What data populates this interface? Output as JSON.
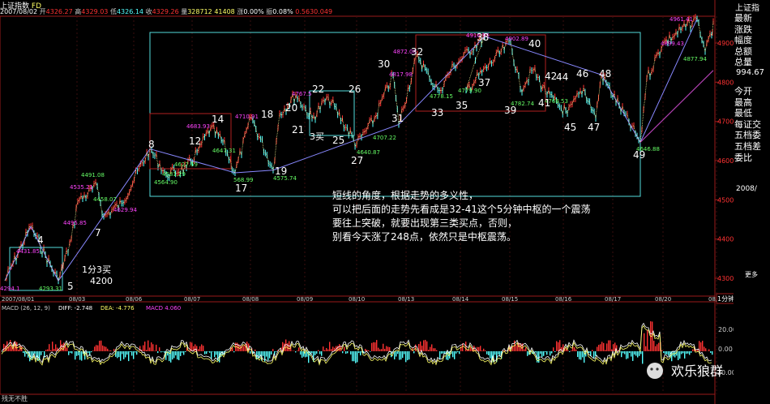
{
  "header": {
    "title": "上证指数",
    "period": "FD",
    "date": "2007/08/02",
    "open_label": "开",
    "open": "4326.27",
    "high_label": "高",
    "high": "4329.03",
    "low_label": "低",
    "low": "4326.14",
    "close_label": "收",
    "close": "4329.26",
    "volume_label": "量",
    "volume": "328712",
    "amount": "41408",
    "change_label": "涨",
    "change": "0.00%",
    "amplitude_label": "振",
    "amplitude": "0.08%",
    "extra": "0.5630.049"
  },
  "right_panel": {
    "title": "上证指",
    "items": [
      "最新",
      "涨跌",
      "幅度",
      "总额",
      "总量",
      "今开",
      "最高",
      "最低",
      "每证交",
      "五档委",
      "五档差",
      "委比"
    ],
    "price": "994.67",
    "misc": [
      "2008/",
      "更多"
    ],
    "period_button": "1分钟"
  },
  "chart_data": {
    "type": "line",
    "title": "",
    "xlabel": "",
    "ylabel": "",
    "ylim": [
      4270,
      4990
    ],
    "x_ticks": [
      "2007/08/01",
      "08/03",
      "08/06",
      "08/07",
      "08/08",
      "08/09",
      "08/10",
      "08/13",
      "08/14",
      "08/15",
      "08/16",
      "08/17",
      "08/20",
      "08/21"
    ],
    "y_ticks": [
      4300,
      4400,
      4500,
      4600,
      4700,
      4800,
      4900
    ],
    "series": [
      {
        "values": [
          4294.1,
          4431.85,
          4293.31,
          4400,
          4495.85,
          4535.21,
          4458.07,
          4491.08,
          4629.94,
          4564.9,
          4581.29,
          4627.69,
          4683.93,
          4647.31,
          4568.99,
          4710.91,
          4575.74,
          4720.0,
          4767.5,
          4708.0,
          4762.0,
          4640.87,
          4707.22,
          4817.98,
          4692.2,
          4872.08,
          4809.0,
          4778.15,
          4842.18,
          4916.95,
          4779.9,
          4902.89,
          4782.74,
          4830.0,
          4768.53,
          4720.0,
          4785.0,
          4708.0,
          4819.0,
          4646.88,
          4810.0,
          4899.43,
          4961.41,
          4877.94,
          4920.0,
          4955.0
        ]
      }
    ],
    "wave_labels": [
      "4",
      "5",
      "7",
      "8",
      "12",
      "14",
      "17",
      "18",
      "19",
      "20",
      "21",
      "22",
      "25",
      "26",
      "27",
      "30",
      "31",
      "32",
      "33",
      "35",
      "37",
      "38",
      "39",
      "40",
      "41",
      "42",
      "44",
      "45",
      "46",
      "47",
      "48",
      "49"
    ],
    "price_labels": [
      "4294.1",
      "4431.85",
      "4293.31",
      "4495.85",
      "4535.21",
      "4458.07",
      "4491.08",
      "4629.94",
      "4564.90",
      "4581.29",
      "4627.69",
      "4683.93",
      "4647.31",
      "568.99",
      "4710.91",
      "4575.74",
      "4767.5",
      "4640.87",
      "4707.22",
      "4817.98",
      "4872.08",
      "4778.15",
      "4779.90",
      "4916.95",
      "4902.89",
      "4782.74",
      "4768.53",
      "4646.88",
      "4899.43",
      "4961.41",
      "4877.94"
    ],
    "buy_labels": [
      "1分3买",
      "3买"
    ],
    "level_label": "4200",
    "annotation": [
      "短线的角度，根据走势的多义性，",
      "可以把后面的走势先看成是32-41这个5分钟中枢的一个震荡",
      "要往上突破，就要出现第三类买点，否则，",
      "别看今天涨了248点，依然只是中枢震荡。"
    ]
  },
  "macd": {
    "label": "MACD (26, 12, 9)",
    "diff_label": "DIFF: -2.748",
    "dea_label": "DEA: -4.776",
    "macd_value_label": "MACD 4.060",
    "y_ticks": [
      "20.00",
      "0.00",
      "-20.00"
    ],
    "footer": "残无不胜"
  },
  "watermark": "欢乐狼群",
  "colors": {
    "up": "#ff3232",
    "down": "#54ffff",
    "price_line": "#ffffff",
    "label_magenta": "#ff44ff",
    "label_green": "#66ff66",
    "box_cyan": "#55dddd",
    "box_red": "#b02020",
    "axis": "#9a1a1a",
    "macd_line": "#ffff66"
  }
}
